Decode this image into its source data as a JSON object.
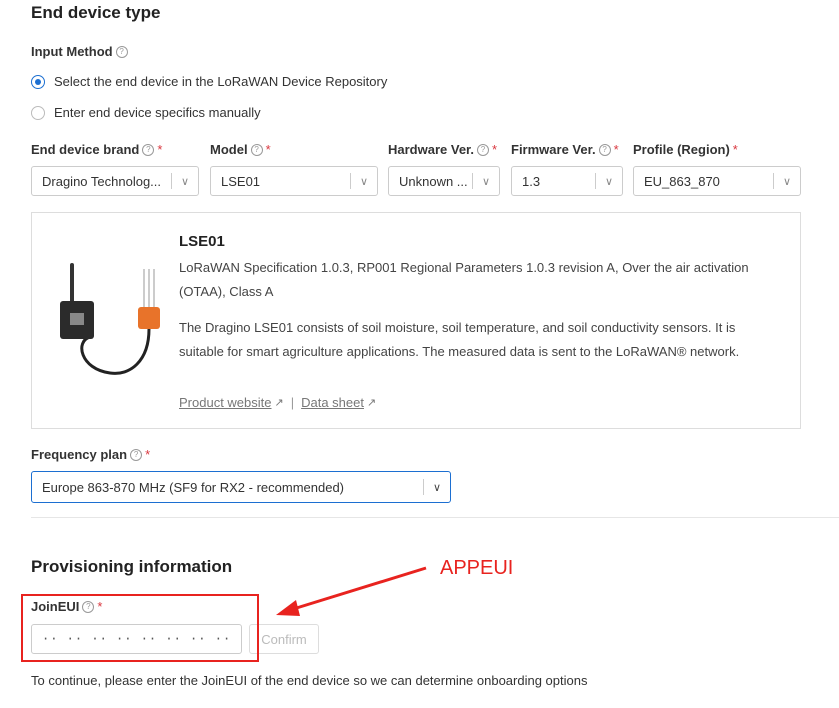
{
  "section_device_type": {
    "title": "End device type"
  },
  "input_method": {
    "label": "Input Method",
    "options": [
      {
        "label": "Select the end device in the LoRaWAN Device Repository",
        "checked": true
      },
      {
        "label": "Enter end device specifics manually",
        "checked": false
      }
    ]
  },
  "fields": {
    "brand": {
      "label": "End device brand",
      "value": "Dragino Technolog..."
    },
    "model": {
      "label": "Model",
      "value": "LSE01"
    },
    "hardware": {
      "label": "Hardware Ver.",
      "value": "Unknown ..."
    },
    "firmware": {
      "label": "Firmware Ver.",
      "value": "1.3"
    },
    "profile": {
      "label": "Profile (Region)",
      "value": "EU_863_870"
    }
  },
  "device_card": {
    "name": "LSE01",
    "spec": "LoRaWAN Specification 1.0.3, RP001 Regional Parameters 1.0.3 revision A, Over the air activation",
    "spec2": "(OTAA), Class A",
    "desc1": "The Dragino LSE01 consists of soil moisture, soil temperature, and soil conductivity sensors. It is",
    "desc2": "suitable for smart agriculture applications. The measured data is sent to the LoRaWAN® network.",
    "product_link": "Product website",
    "separator": "|",
    "datasheet_link": "Data sheet"
  },
  "frequency_plan": {
    "label": "Frequency plan",
    "value": "Europe 863-870 MHz (SF9 for RX2 - recommended)"
  },
  "provisioning": {
    "title": "Provisioning information",
    "joineui_label": "JoinEUI",
    "joineui_value": "·· ·· ·· ·· ·· ·· ·· ··",
    "confirm_label": "Confirm",
    "hint": "To continue, please enter the JoinEUI of the end device so we can determine onboarding options"
  },
  "annotation": {
    "text": "APPEUI",
    "color": "#e8231f"
  },
  "colors": {
    "accent": "#1c6fd1",
    "required": "#d9363e",
    "sensor_orange": "#e8732a"
  }
}
